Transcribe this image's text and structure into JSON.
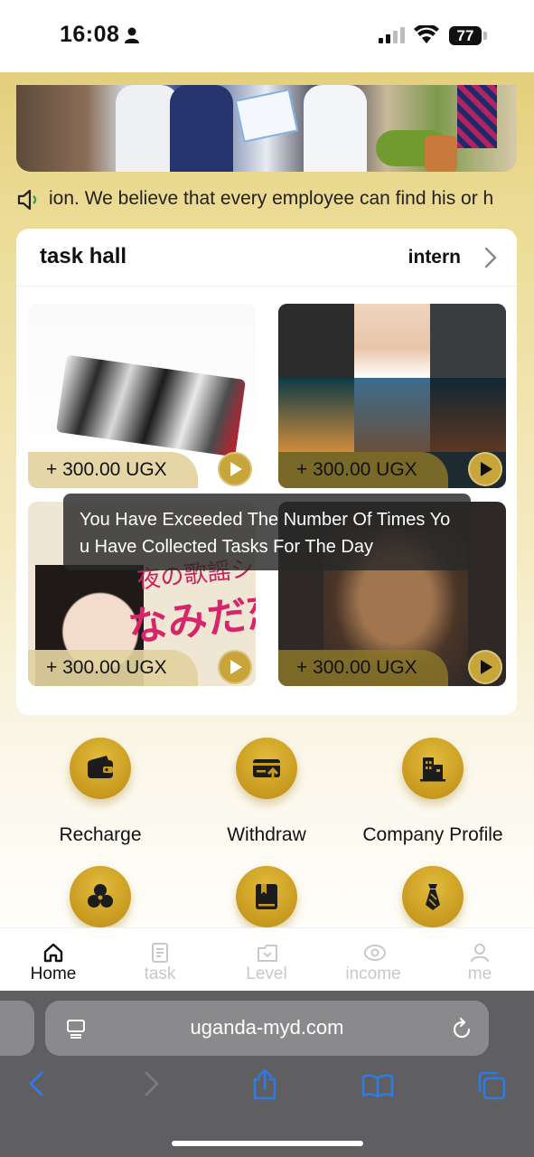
{
  "status_bar": {
    "time": "16:08",
    "battery": "77"
  },
  "notice": {
    "text": "ion. We believe that every employee can find his or h"
  },
  "task_hall": {
    "title": "task hall",
    "more_label": "intern",
    "cards": [
      {
        "price": "+ 300.00 UGX"
      },
      {
        "price": "+ 300.00 UGX"
      },
      {
        "price": "+ 300.00 UGX",
        "poster_line1": "夜の歌謡シリーズ",
        "poster_line2": "なみだ恋"
      },
      {
        "price": "+ 300.00 UGX"
      }
    ]
  },
  "toast": {
    "message": "You Have Exceeded The Number Of Times You Have Collected Tasks For The Day"
  },
  "actions": [
    {
      "label": "Recharge",
      "icon": "wallet-icon"
    },
    {
      "label": "Withdraw",
      "icon": "withdraw-card-icon"
    },
    {
      "label": "Company Profile",
      "icon": "building-icon"
    },
    {
      "label": "",
      "icon": "circles-icon"
    },
    {
      "label": "",
      "icon": "book-icon"
    },
    {
      "label": "",
      "icon": "tie-icon"
    }
  ],
  "tabbar": {
    "tabs": [
      {
        "label": "Home",
        "icon": "home-icon",
        "active": true
      },
      {
        "label": "task",
        "icon": "document-icon",
        "active": false
      },
      {
        "label": "Level",
        "icon": "level-icon",
        "active": false
      },
      {
        "label": "income",
        "icon": "eye-icon",
        "active": false
      },
      {
        "label": "me",
        "icon": "user-icon",
        "active": false
      }
    ]
  },
  "browser": {
    "url": "uganda-myd.com"
  },
  "colors": {
    "gold_accent": "#c89a1f",
    "page_gradient_top": "#e3cf7c",
    "browser_chrome": "#5f5f61",
    "ios_blue": "#2d7be5"
  }
}
